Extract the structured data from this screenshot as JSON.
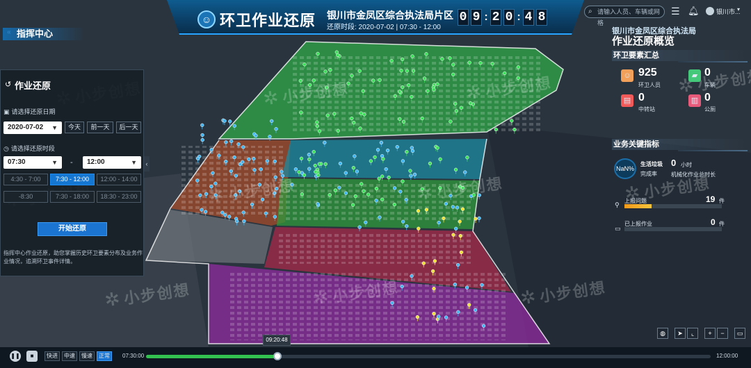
{
  "header": {
    "app_title": "环卫作业还原",
    "district": "银川市金凤区综合执法局片区",
    "time_range": "还原时段:  2020-07-02 | 07:30 - 12:00",
    "clock_digits": [
      "0",
      "9",
      "2",
      "0",
      "4",
      "8"
    ]
  },
  "topbar": {
    "search_placeholder": "请输入人员、车辆或网格",
    "user_name": "银川市..."
  },
  "nav": {
    "command_center": "指挥中心"
  },
  "left_panel": {
    "title": "作业还原",
    "date_label": "请选择还原日期",
    "date_value": "2020-07-02",
    "btn_today": "今天",
    "btn_prev": "前一天",
    "btn_next": "后一天",
    "period_label": "请选择还原时段",
    "start_time": "07:30",
    "end_time": "12:00",
    "dash": "-",
    "slots": [
      "4:30 - 7:00",
      "7:30 - 12:00",
      "12:00 - 14:00",
      "-8:30",
      "7:30 - 18:00",
      "18:30 - 23:00"
    ],
    "start_button": "开始还原",
    "description": "指挥中心作业还原，助您掌握历史环卫要素分布及业务作业情况，追溯环卫事件详情。"
  },
  "right_panel": {
    "org": "银川市金凤区综合执法局",
    "title": "作业还原概览",
    "summary_head": "环卫要素汇总",
    "stats": [
      {
        "value": "925",
        "label": "环卫人员",
        "icon": "worker-icon"
      },
      {
        "value": "0",
        "label": "车辆",
        "icon": "truck-icon"
      },
      {
        "value": "0",
        "label": "中转站",
        "icon": "station-icon"
      },
      {
        "value": "0",
        "label": "公厕",
        "icon": "toilet-icon"
      }
    ],
    "kpi_head": "业务关键指标",
    "nan": "NaN%",
    "garbage_label": "生活垃圾",
    "completion": "完成率",
    "hours_value": "0",
    "hours_unit": "小时",
    "mech_label": "机械化作业总时长",
    "issue_label": "上报问题",
    "issue_value": "19",
    "issue_unit": "件",
    "issue_fraction": 0.28,
    "done_label": "已上报作业",
    "done_value": "0",
    "done_unit": "件"
  },
  "playback": {
    "speeds": [
      "快进",
      "中速",
      "慢速",
      "正常"
    ],
    "active_speed": "正常",
    "start": "07:30:00",
    "end": "12:00:00",
    "current": "09:20:48",
    "progress": 0.23
  },
  "watermark": "小步创想",
  "colors": {
    "accent": "#1a74d0",
    "green_zone": "#2fa84a",
    "purple_zone": "#8a2c9a",
    "red_zone": "#a3294a",
    "brown_zone": "#9c4a2a",
    "cyan_zone": "#1e8aa0"
  }
}
